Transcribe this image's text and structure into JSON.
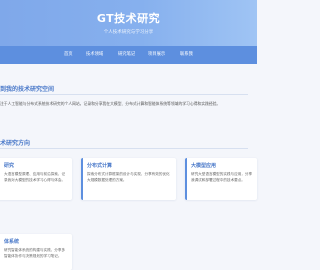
{
  "hero": {
    "title": "GT技术研究",
    "subtitle": "个人技术研究与学习分享"
  },
  "nav": {
    "items": [
      "首页",
      "技术领域",
      "研究笔记",
      "项目展示",
      "联系我"
    ]
  },
  "welcome": {
    "title": "到我的技术研究空间",
    "text": "注于人工智能与分布式系统技术研究的个人网站，记录和分享我在大模型、分布式计算和智能体系统等领域的学习心得和实践经验。"
  },
  "directions": {
    "title": "术研究方向",
    "cards": [
      {
        "title": "研究",
        "desc": "大语言模型原理、应用与前沿探索，记录我对大模型的技术学习心得与体会。"
      },
      {
        "title": "分布式计算",
        "desc": "探索分布式计算框架的设计与实现，分享有效的优化大规模数据处理的方案。"
      },
      {
        "title": "大模型应用",
        "desc": "研究大型语言模型的实践与应用，分享我调试和部署过程中的技术要点。"
      },
      {
        "title": "体系统",
        "desc": "研究智能体系统的构建与实践，分享多智能体协作与决策规划的学习笔记。"
      }
    ]
  }
}
